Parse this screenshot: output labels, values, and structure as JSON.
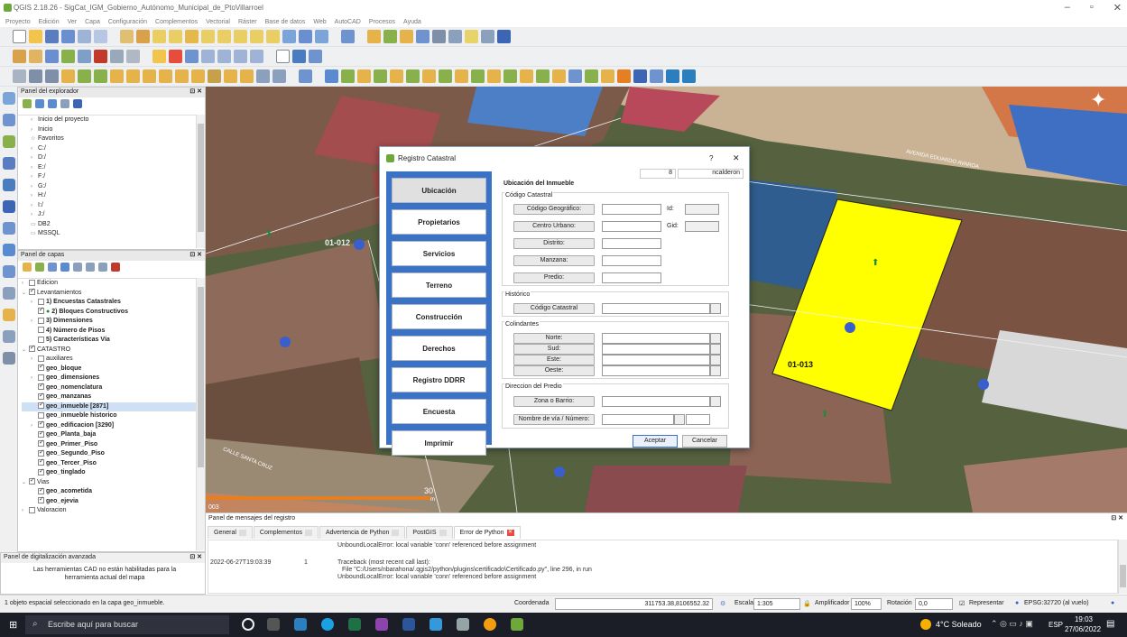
{
  "window": {
    "title": "QGIS 2.18.26 - SigCat_IGM_Gobierno_Autónomo_Municipal_de_PtoVillarroel",
    "controls": [
      "–",
      "▫",
      "✕"
    ]
  },
  "menu": [
    "Proyecto",
    "Edición",
    "Ver",
    "Capa",
    "Configuración",
    "Complementos",
    "Vectorial",
    "Ráster",
    "Base de datos",
    "Web",
    "AutoCAD",
    "Procesos",
    "Ayuda"
  ],
  "explorer_panel": {
    "title": "Panel del explorador",
    "items": [
      "Inicio del proyecto",
      "Inicio",
      "Favoritos",
      "C:/",
      "D:/",
      "E:/",
      "F:/",
      "G:/",
      "H:/",
      "I:/",
      "J:/",
      "DB2",
      "MSSQL"
    ]
  },
  "layers_panel": {
    "title": "Panel de capas",
    "items": [
      {
        "label": "Edicion",
        "bold": false
      },
      {
        "label": "Levantamientos",
        "bold": false
      },
      {
        "label": "1) Encuestas Catastrales",
        "bold": true
      },
      {
        "label": "2) Bloques Constructivos",
        "bold": true
      },
      {
        "label": "3) Dimensiones",
        "bold": true
      },
      {
        "label": "4) Número de Pisos",
        "bold": true
      },
      {
        "label": "5) Características Vía",
        "bold": true
      },
      {
        "label": "CATASTRO",
        "bold": false
      },
      {
        "label": "auxiliares",
        "bold": false
      },
      {
        "label": "geo_bloque",
        "bold": true
      },
      {
        "label": "geo_dimensiones",
        "bold": true
      },
      {
        "label": "geo_nomenclatura",
        "bold": true
      },
      {
        "label": "geo_manzanas",
        "bold": true
      },
      {
        "label": "geo_inmueble [2871]",
        "bold": true
      },
      {
        "label": "geo_inmueble historico",
        "bold": true
      },
      {
        "label": "geo_edificacion [3290]",
        "bold": true
      },
      {
        "label": "geo_Planta_baja",
        "bold": true
      },
      {
        "label": "geo_Primer_Piso",
        "bold": true
      },
      {
        "label": "geo_Segundo_Piso",
        "bold": true
      },
      {
        "label": "geo_Tercer_Piso",
        "bold": true
      },
      {
        "label": "geo_tinglado",
        "bold": true
      },
      {
        "label": "Vias",
        "bold": false
      },
      {
        "label": "geo_acometida",
        "bold": true
      },
      {
        "label": "geo_ejevia",
        "bold": true
      },
      {
        "label": "Valoracion",
        "bold": false
      }
    ]
  },
  "digitizing_panel": {
    "title": "Panel de digitalización avanzada",
    "message": "Las herramientas CAD no están habilitadas para la herramienta actual del mapa"
  },
  "map": {
    "labels": {
      "parcel_left": "01-012",
      "parcel_right": "01-013",
      "street_1": "AVENIDA EDUARDO AVAROA",
      "street_2": "CALLE SANTA CRUZ",
      "scale_bar": "30",
      "scale_unit": "m",
      "corner_code": "003"
    },
    "colors": {
      "highlight": "#ffff00"
    }
  },
  "dialog": {
    "title": "Registro Catastral",
    "help": "?",
    "close": "✕",
    "header_num": "8",
    "header_user": "ncalderon",
    "nav": [
      "Ubicación",
      "Propietarios",
      "Servicios",
      "Terreno",
      "Construcción",
      "Derechos",
      "Registro DDRR",
      "Encuesta",
      "Imprimir"
    ],
    "section_title": "Ubicación del Inmueble",
    "groups": {
      "codigo": "Código Catastral",
      "historico": "Histórico",
      "colindantes": "Colindantes",
      "direccion": "Direccion del Predio"
    },
    "fields": {
      "codigo_geo": "Código Geográfico:",
      "centro_urbano": "Centro Urbano:",
      "distrito": "Distrito:",
      "manzana": "Manzana:",
      "predio": "Predio:",
      "id": "Id:",
      "gid": "Gid:",
      "hist_codigo": "Código Catastral",
      "norte": "Norte:",
      "sud": "Sud:",
      "este": "Este:",
      "oeste": "Oeste:",
      "zona": "Zona o Barrio:",
      "via": "Nombre de vía / Número:"
    },
    "accept": "Aceptar",
    "cancel": "Cancelar"
  },
  "messages_panel": {
    "title": "Panel de mensajes del registro",
    "tabs": [
      "General",
      "Complementos",
      "Advertencia de Python",
      "PostGIS",
      "Error de Python"
    ],
    "lines": [
      {
        "time": "",
        "level": "",
        "text": "UnboundLocalError: local variable 'conn' referenced before assignment"
      },
      {
        "time": "2022-06-27T19:03:39",
        "level": "1",
        "text": "Traceback (most recent call last):"
      },
      {
        "time": "",
        "level": "",
        "text": "File \"C:/Users/nbarahona/.qgis2/python/plugins\\certificado\\Certificado.py\", line 296, in run"
      },
      {
        "time": "",
        "level": "",
        "text": "UnboundLocalError: local variable 'conn' referenced before assignment"
      }
    ]
  },
  "statusbar": {
    "selection": "1 objeto espacial seleccionado en la capa geo_inmueble.",
    "coord_label": "Coordenada",
    "coord_value": "311753.38,8106552.32",
    "scale_label": "Escala",
    "scale_value": "1:305",
    "magnifier_label": "Amplificador",
    "magnifier_value": "100%",
    "rotation_label": "Rotación",
    "rotation_value": "0,0",
    "render_label": "Representar",
    "crs": "EPSG:32720 (al vuelo)"
  },
  "taskbar": {
    "search_placeholder": "Escribe aquí para buscar",
    "weather": "4°C Soleado",
    "lang": "ESP",
    "time": "19:03",
    "date": "27/06/2022"
  }
}
